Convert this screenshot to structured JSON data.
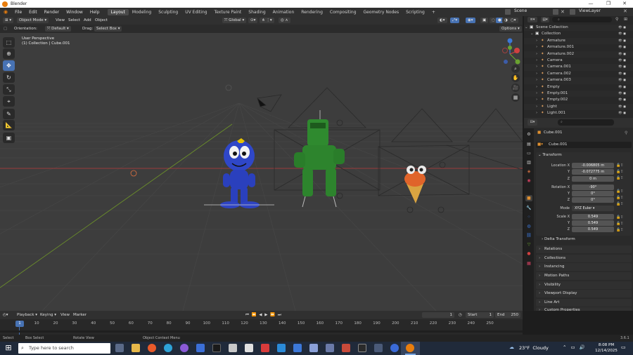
{
  "window": {
    "title": "Blender",
    "controls": [
      "—",
      "❐",
      "✕"
    ]
  },
  "menubar": {
    "menus": [
      "File",
      "Edit",
      "Render",
      "Window",
      "Help"
    ],
    "workspaces": [
      "Layout",
      "Modeling",
      "Sculpting",
      "UV Editing",
      "Texture Paint",
      "Shading",
      "Animation",
      "Rendering",
      "Compositing",
      "Geometry Nodes",
      "Scripting"
    ],
    "active_workspace": "Layout",
    "add_tab": "+",
    "scene": "Scene",
    "view_layer": "ViewLayer"
  },
  "viewport_header": {
    "mode": "Object Mode",
    "menus": [
      "View",
      "Select",
      "Add",
      "Object"
    ],
    "transform": "Global",
    "orientation_label": "Orientation:",
    "orientation_value": "Default",
    "drag_label": "Drag:",
    "drag_value": "Select Box",
    "options": "Options"
  },
  "viewport": {
    "view_name": "User Perspective",
    "collection_info": "(1) Collection | Cube.001"
  },
  "outliner": {
    "search_placeholder": "",
    "items": [
      {
        "name": "Scene Collection",
        "depth": 0,
        "icon_color": "#e8e8e8"
      },
      {
        "name": "Collection",
        "depth": 1,
        "icon_color": "#e8e8e8"
      },
      {
        "name": "Armature",
        "depth": 2,
        "icon_color": "#e0a060"
      },
      {
        "name": "Armature.001",
        "depth": 2,
        "icon_color": "#e0a060"
      },
      {
        "name": "Armature.002",
        "depth": 2,
        "icon_color": "#e0a060"
      },
      {
        "name": "Camera",
        "depth": 2,
        "icon_color": "#e0a060"
      },
      {
        "name": "Camera.001",
        "depth": 2,
        "icon_color": "#e0a060"
      },
      {
        "name": "Camera.002",
        "depth": 2,
        "icon_color": "#e0a060"
      },
      {
        "name": "Camera.003",
        "depth": 2,
        "icon_color": "#e0a060"
      },
      {
        "name": "Empty",
        "depth": 2,
        "icon_color": "#e0a060"
      },
      {
        "name": "Empty.001",
        "depth": 2,
        "icon_color": "#e0a060"
      },
      {
        "name": "Empty.002",
        "depth": 2,
        "icon_color": "#e0a060"
      },
      {
        "name": "Light",
        "depth": 2,
        "icon_color": "#e0a060"
      },
      {
        "name": "Light.001",
        "depth": 2,
        "icon_color": "#e0a060"
      }
    ]
  },
  "properties": {
    "object_name": "Cube.001",
    "data_name": "Cube.001",
    "transform_header": "Transform",
    "location": {
      "label_x": "Location X",
      "label_y": "Y",
      "label_z": "Z",
      "x": "-0.006805 m",
      "y": "-0.072775 m",
      "z": "0 m"
    },
    "rotation": {
      "label_x": "Rotation X",
      "label_y": "Y",
      "label_z": "Z",
      "x": "-90°",
      "y": "0°",
      "z": "0°"
    },
    "mode_label": "Mode",
    "mode_value": "XYZ Euler",
    "scale": {
      "label_x": "Scale X",
      "label_y": "Y",
      "label_z": "Z",
      "x": "0.549",
      "y": "0.549",
      "z": "0.549"
    },
    "delta_transform": "Delta Transform",
    "sections": [
      "Relations",
      "Collections",
      "Instancing",
      "Motion Paths",
      "Visibility",
      "Viewport Display",
      "Line Art",
      "Custom Properties"
    ]
  },
  "timeline": {
    "menus": [
      "Playback",
      "Keying",
      "View",
      "Marker"
    ],
    "current_frame": "1",
    "start_label": "Start",
    "start_value": "1",
    "end_label": "End",
    "end_value": "250",
    "ruler": [
      "10",
      "20",
      "30",
      "40",
      "50",
      "60",
      "70",
      "80",
      "90",
      "100",
      "110",
      "120",
      "130",
      "140",
      "150",
      "160",
      "170",
      "180",
      "190",
      "200",
      "210",
      "220",
      "230",
      "240",
      "250"
    ],
    "playhead": "1"
  },
  "statusbar": {
    "items": [
      "Select",
      "Box Select",
      "Rotate View",
      "Object Context Menu"
    ],
    "version": "3.6.1"
  },
  "taskbar": {
    "search_placeholder": "Type here to search",
    "weather": "23°F  Cloudy",
    "time": "8:08 PM",
    "date": "12/14/2025"
  },
  "colors": {
    "accent": "#4772b3",
    "blender_orange": "#e87d0d",
    "grid_x_axis": "#9c3a3a",
    "grid_y_axis": "#6b8f2a"
  }
}
